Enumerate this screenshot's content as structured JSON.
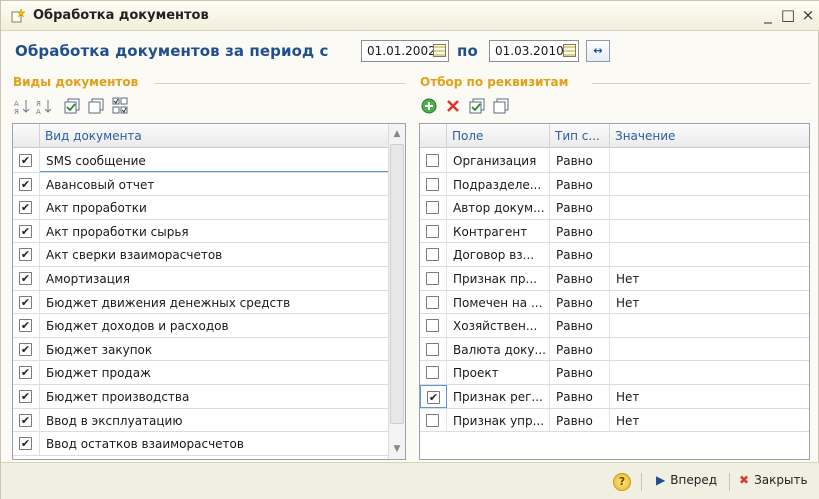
{
  "window": {
    "title": "Обработка документов",
    "controls": [
      "_",
      "□",
      "×"
    ]
  },
  "period": {
    "label": "Обработка документов за период с",
    "from": "01.01.2002",
    "to_label": "по",
    "to": "01.03.2010",
    "period_button_icon": "↔"
  },
  "doc_types": {
    "header": "Виды документов",
    "toolbar": [
      "sort-asc-icon",
      "sort-desc-icon",
      "check-all-icon",
      "uncheck-all-icon",
      "invert-check-icon"
    ],
    "column": "Вид документа",
    "rows": [
      {
        "checked": true,
        "name": "SMS сообщение"
      },
      {
        "checked": true,
        "name": "Авансовый отчет"
      },
      {
        "checked": true,
        "name": "Акт проработки"
      },
      {
        "checked": true,
        "name": "Акт проработки сырья"
      },
      {
        "checked": true,
        "name": "Акт сверки взаиморасчетов"
      },
      {
        "checked": true,
        "name": "Амортизация"
      },
      {
        "checked": true,
        "name": "Бюджет движения денежных средств"
      },
      {
        "checked": true,
        "name": "Бюджет доходов и расходов"
      },
      {
        "checked": true,
        "name": "Бюджет закупок"
      },
      {
        "checked": true,
        "name": "Бюджет продаж"
      },
      {
        "checked": true,
        "name": "Бюджет производства"
      },
      {
        "checked": true,
        "name": "Ввод в эксплуатацию"
      },
      {
        "checked": true,
        "name": "Ввод остатков взаиморасчетов"
      }
    ]
  },
  "filters": {
    "header": "Отбор по реквизитам",
    "toolbar": [
      "add-icon",
      "delete-icon",
      "check-all-icon",
      "uncheck-all-icon"
    ],
    "columns": [
      "Поле",
      "Тип с...",
      "Значение"
    ],
    "rows": [
      {
        "checked": false,
        "field": "Организация",
        "type": "Равно",
        "value": ""
      },
      {
        "checked": false,
        "field": "Подразделе...",
        "type": "Равно",
        "value": ""
      },
      {
        "checked": false,
        "field": "Автор докум...",
        "type": "Равно",
        "value": ""
      },
      {
        "checked": false,
        "field": "Контрагент",
        "type": "Равно",
        "value": ""
      },
      {
        "checked": false,
        "field": "Договор вз...",
        "type": "Равно",
        "value": ""
      },
      {
        "checked": false,
        "field": "Признак пр...",
        "type": "Равно",
        "value": "Нет"
      },
      {
        "checked": false,
        "field": "Помечен на ...",
        "type": "Равно",
        "value": "Нет"
      },
      {
        "checked": false,
        "field": "Хозяйствен...",
        "type": "Равно",
        "value": ""
      },
      {
        "checked": false,
        "field": "Валюта доку...",
        "type": "Равно",
        "value": ""
      },
      {
        "checked": false,
        "field": "Проект",
        "type": "Равно",
        "value": ""
      },
      {
        "checked": true,
        "field": "Признак рег...",
        "type": "Равно",
        "value": "Нет"
      },
      {
        "checked": false,
        "field": "Признак упр...",
        "type": "Равно",
        "value": "Нет"
      }
    ]
  },
  "footer": {
    "help_icon": "?",
    "next_label": "Вперед",
    "close_label": "Закрыть"
  }
}
